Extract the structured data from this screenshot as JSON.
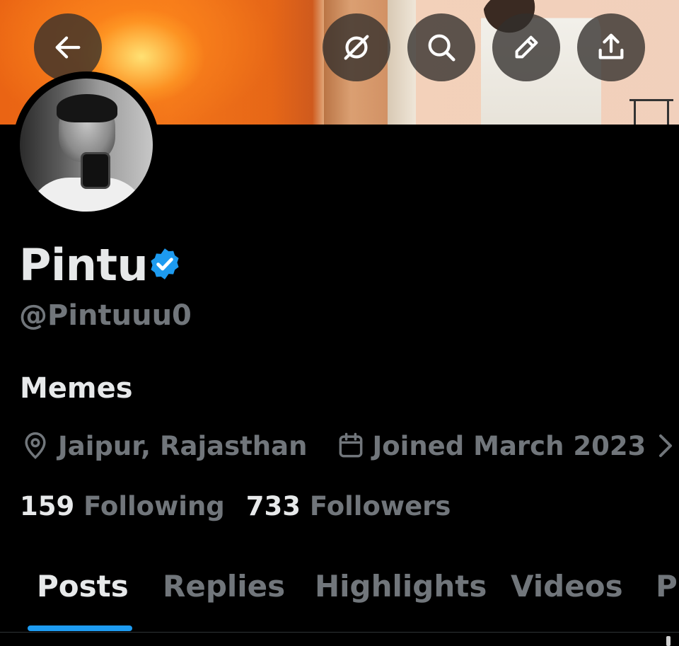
{
  "header": {
    "buttons": [
      {
        "name": "back-button",
        "icon": "arrow-left-icon"
      },
      {
        "name": "grok-button",
        "icon": "grok-slash-icon"
      },
      {
        "name": "search-button",
        "icon": "search-icon"
      },
      {
        "name": "edit-button",
        "icon": "pencil-icon"
      },
      {
        "name": "share-button",
        "icon": "upload-share-icon"
      }
    ]
  },
  "profile": {
    "display_name": "Pintu",
    "verified": true,
    "verified_color": "#1d9bf0",
    "handle": "@Pintuuu0",
    "bio": "Memes",
    "location": "Jaipur, Rajasthan",
    "joined": "Joined March 2023",
    "following_count": "159",
    "following_label": "Following",
    "followers_count": "733",
    "followers_label": "Followers"
  },
  "tabs": [
    {
      "label": "Posts",
      "active": true
    },
    {
      "label": "Replies",
      "active": false
    },
    {
      "label": "Highlights",
      "active": false
    },
    {
      "label": "Videos",
      "active": false
    },
    {
      "label": "Pl",
      "active": false
    }
  ],
  "colors": {
    "background": "#000000",
    "primary_text": "#e7e9ea",
    "secondary_text": "#71767b",
    "accent": "#1d9bf0"
  }
}
